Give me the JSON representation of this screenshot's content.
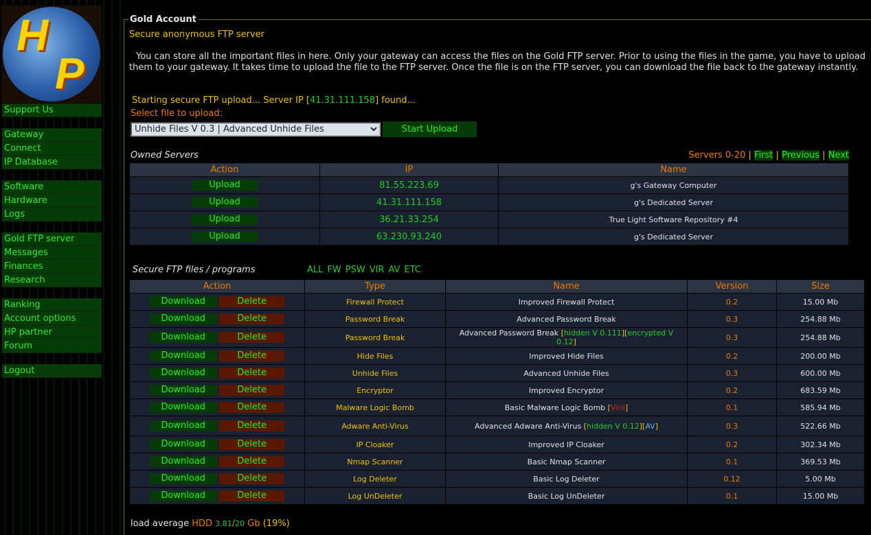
{
  "logo": {
    "text": "HP"
  },
  "sidebar": {
    "groups": [
      [
        "Support Us"
      ],
      [
        "Gateway",
        "Connect",
        "IP Database"
      ],
      [
        "Software",
        "Hardware",
        "Logs"
      ],
      [
        "Gold FTP server",
        "Messages",
        "Finances",
        "Research"
      ],
      [
        "Ranking",
        "Account options",
        "HP partner",
        "Forum"
      ],
      [
        "Logout"
      ]
    ]
  },
  "page": {
    "legend": "Gold Account",
    "subtitle": "Secure anonymous FTP server",
    "description": "You can store all the important files in here. Only your gateway can access the files on the Gold FTP server. Prior to using the files in the game, you have to upload them to your gateway. It takes time to upload the file to the FTP server. Once the file is on the FTP server, you can download the file back to the gateway instantly.",
    "status_prefix": "Starting secure FTP upload... Server IP [",
    "status_ip": "41.31.111.158",
    "status_suffix": "] found...",
    "select_label": "Select file to upload:",
    "select_value": "Unhide Files V 0.3 | Advanced Unhide Files",
    "start_upload": "Start Upload"
  },
  "servers": {
    "title": "Owned Servers",
    "range_label": "Servers",
    "range": "0-20",
    "first": "First",
    "previous": "Previous",
    "next": "Next",
    "headers": [
      "Action",
      "IP",
      "Name"
    ],
    "rows": [
      {
        "action": "Upload",
        "ip": "81.55.223.69",
        "name": "g's Gateway Computer"
      },
      {
        "action": "Upload",
        "ip": "41.31.111.158",
        "name": "g's Dedicated Server"
      },
      {
        "action": "Upload",
        "ip": "36.21.33.254",
        "name": "True Light Software Repository #4"
      },
      {
        "action": "Upload",
        "ip": "63.230.93.240",
        "name": "g's Dedicated Server"
      }
    ]
  },
  "files": {
    "title": "Secure FTP files / programs",
    "filters": [
      "ALL",
      "FW",
      "PSW",
      "VIR",
      "AV",
      "ETC"
    ],
    "headers": [
      "Action",
      "Type",
      "Name",
      "Version",
      "Size"
    ],
    "download": "Download",
    "delete": "Delete",
    "rows": [
      {
        "type": "Firewall Protect",
        "name": "Improved Firewall Protect",
        "tags": [],
        "version": "0.2",
        "size": "15.00 Mb"
      },
      {
        "type": "Password Break",
        "name": "Advanced Password Break",
        "tags": [],
        "version": "0.3",
        "size": "254.88 Mb"
      },
      {
        "type": "Password Break",
        "name": "Advanced Password Break",
        "tags": [
          {
            "text": "hidden V 0.111",
            "color": "#22cc22"
          },
          {
            "text": "encrypted V 0.12",
            "color": "#22cc22"
          }
        ],
        "version": "0.3",
        "size": "254.88 Mb"
      },
      {
        "type": "Hide Files",
        "name": "Improved Hide Files",
        "tags": [],
        "version": "0.2",
        "size": "200.00 Mb"
      },
      {
        "type": "Unhide Files",
        "name": "Advanced Unhide Files",
        "tags": [],
        "version": "0.3",
        "size": "600.00 Mb"
      },
      {
        "type": "Encryptor",
        "name": "Improved Encryptor",
        "tags": [],
        "version": "0.2",
        "size": "683.59 Mb"
      },
      {
        "type": "Malware Logic Bomb",
        "name": "Basic Malware Logic Bomb",
        "tags": [
          {
            "text": "Virii",
            "color": "#e02020"
          }
        ],
        "version": "0.1",
        "size": "585.94 Mb"
      },
      {
        "type": "Adware Anti-Virus",
        "name": "Advanced Adware Anti-Virus",
        "tags": [
          {
            "text": "hidden V 0.12",
            "color": "#22cc22"
          },
          {
            "text": "AV",
            "color": "#6ab0f0"
          }
        ],
        "version": "0.3",
        "size": "522.66 Mb"
      },
      {
        "type": "IP Cloaker",
        "name": "Improved IP Cloaker",
        "tags": [],
        "version": "0.2",
        "size": "302.34 Mb"
      },
      {
        "type": "Nmap Scanner",
        "name": "Basic Nmap Scanner",
        "tags": [],
        "version": "0.1",
        "size": "369.53 Mb"
      },
      {
        "type": "Log Deleter",
        "name": "Basic Log Deleter",
        "tags": [],
        "version": "0.12",
        "size": "5.00 Mb"
      },
      {
        "type": "Log UnDeleter",
        "name": "Basic Log UnDeleter",
        "tags": [],
        "version": "0.1",
        "size": "15.00 Mb"
      }
    ]
  },
  "footer": {
    "label": "load average",
    "hdd": "HDD",
    "used": "3.81",
    "total": "20",
    "unit": "Gb",
    "percent": "(19%)"
  },
  "colors": {
    "accent": "#f0c000",
    "orange": "#f07a00",
    "green": "#22cc22",
    "row_bg": "#1a2232"
  }
}
